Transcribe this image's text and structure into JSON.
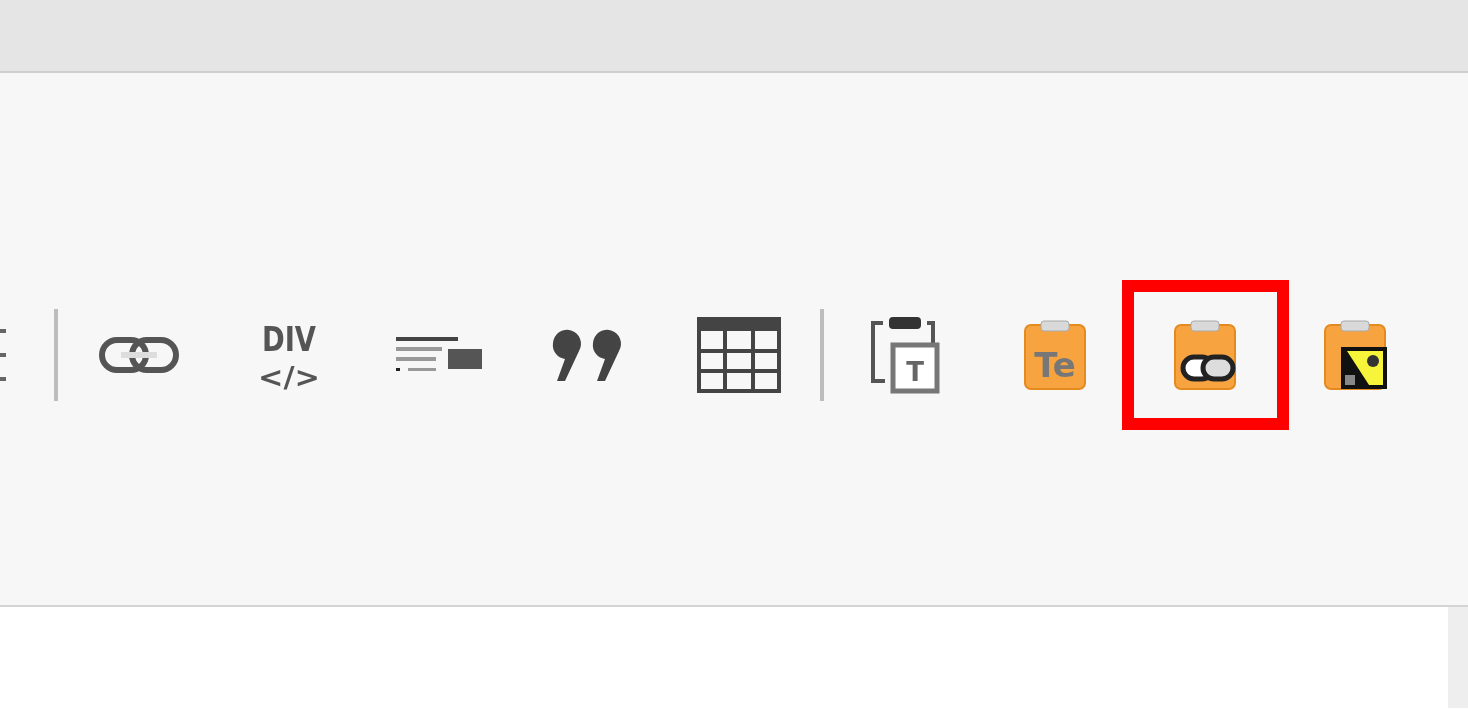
{
  "toolbar": {
    "items": [
      {
        "kind": "partial"
      },
      {
        "kind": "separator"
      },
      {
        "kind": "link",
        "highlighted": false
      },
      {
        "kind": "div",
        "glyphs": [
          "DIV",
          "</>"
        ],
        "highlighted": false
      },
      {
        "kind": "block",
        "highlighted": false
      },
      {
        "kind": "quote",
        "highlighted": false
      },
      {
        "kind": "table",
        "highlighted": false
      },
      {
        "kind": "separator"
      },
      {
        "kind": "paste-text",
        "glyphs": [
          "T"
        ],
        "highlighted": false
      },
      {
        "kind": "paste-word",
        "glyphs": [
          "Te"
        ],
        "highlighted": false
      },
      {
        "kind": "paste-link",
        "highlighted": true
      },
      {
        "kind": "paste-image",
        "highlighted": false
      }
    ]
  }
}
